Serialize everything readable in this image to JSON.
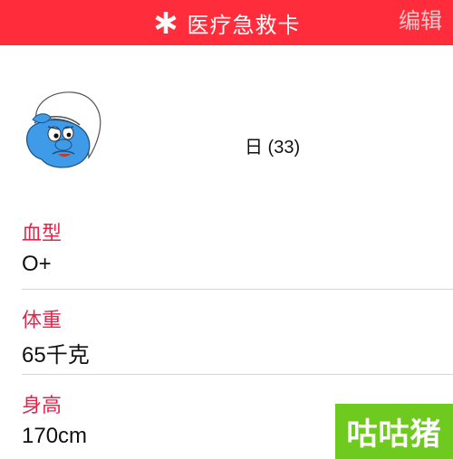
{
  "header": {
    "title": "医疗急救卡",
    "edit_label": "编辑",
    "icon": "medical-asterisk-icon",
    "background_color": "#ff2d3b"
  },
  "profile": {
    "avatar": "smurf-avatar",
    "dob_text": "日 (33)"
  },
  "fields": [
    {
      "label": "血型",
      "value": "O+"
    },
    {
      "label": "体重",
      "value": "65千克"
    },
    {
      "label": "身高",
      "value": "170cm"
    }
  ],
  "label_color": "#e8234a",
  "watermark": {
    "text": "咕咕猪",
    "color": "#6fca1f"
  }
}
